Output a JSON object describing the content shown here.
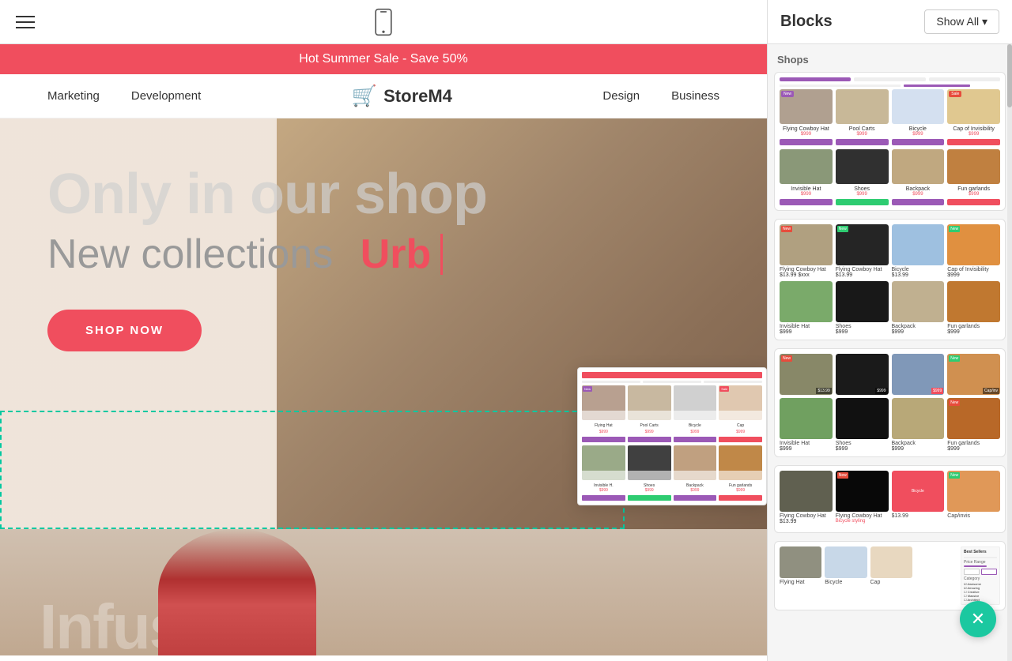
{
  "toolbar": {
    "hamburger_label": "menu",
    "phone_label": "mobile preview"
  },
  "announcement": {
    "text": "Hot Summer Sale - Save 50%"
  },
  "navigation": {
    "links": [
      "Marketing",
      "Development",
      "Design",
      "Business"
    ],
    "logo_text": "StoreM4",
    "logo_icon": "🛒"
  },
  "hero": {
    "title_main": "Only in our shop",
    "subtitle_prefix": "New collections",
    "subtitle_accent": "Urb",
    "cta_button": "SHOP NOW"
  },
  "sidebar": {
    "title": "Blocks",
    "show_all_label": "Show All ▾",
    "section_label": "Shops",
    "blocks": [
      {
        "id": "block1",
        "type": "shops-grid"
      },
      {
        "id": "block2",
        "type": "shops-grid-b"
      },
      {
        "id": "block3",
        "type": "shops-grid-c"
      },
      {
        "id": "block4",
        "type": "shops-grid-d"
      },
      {
        "id": "block5",
        "type": "shops-grid-e"
      }
    ]
  },
  "close_button": {
    "label": "✕"
  }
}
